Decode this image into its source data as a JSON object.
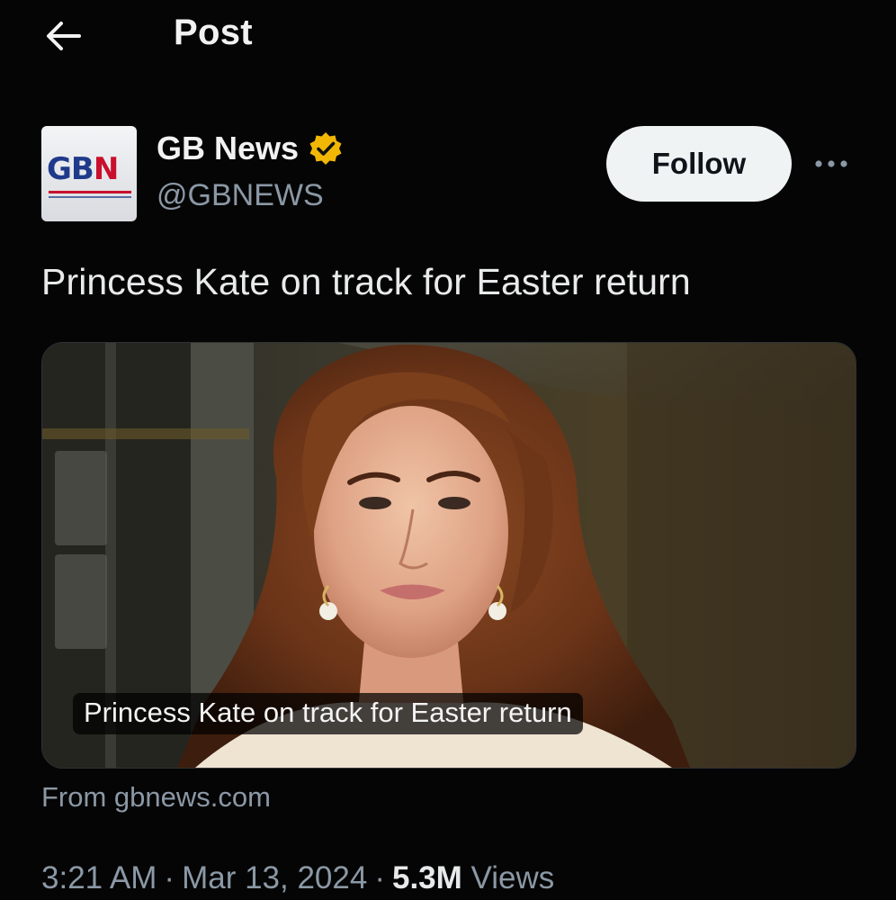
{
  "header": {
    "title": "Post",
    "back_icon": "arrow-left-icon"
  },
  "author": {
    "display_name": "GB News",
    "handle": "@GBNEWS",
    "avatar_logo_text": "GBN",
    "verified_icon": "verified-badge-icon",
    "verified_color": "#f2b705"
  },
  "actions": {
    "follow_label": "Follow",
    "more_icon": "more-horizontal-icon"
  },
  "post": {
    "text": "Princess Kate on track for Easter return"
  },
  "card": {
    "caption": "Princess Kate on track for Easter return",
    "source": "From gbnews.com"
  },
  "meta": {
    "time": "3:21 AM",
    "date": "Mar 13, 2024",
    "views_count": "5.3M",
    "views_label": "Views"
  },
  "colors": {
    "background": "#000000",
    "text_primary": "#e7e9ea",
    "text_secondary": "#8b98a5",
    "follow_bg": "#eff3f4"
  }
}
